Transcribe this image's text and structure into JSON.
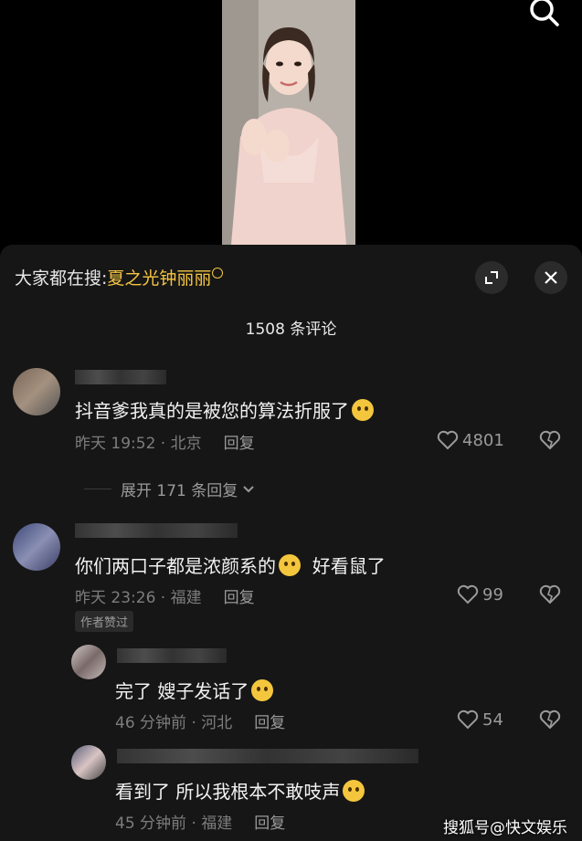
{
  "search": {
    "prefix": "大家都在搜:",
    "keyword": "夏之光钟丽丽"
  },
  "comments_count": "1508 条评论",
  "comments": [
    {
      "text": "抖音爹我真的是被您的算法折服了",
      "time": "昨天 19:52",
      "location": "北京",
      "reply": "回复",
      "likes": "4801",
      "expand": "展开 171 条回复"
    },
    {
      "text_a": "你们两口子都是浓颜系的",
      "text_b": "好看鼠了",
      "time": "昨天 23:26",
      "location": "福建",
      "reply": "回复",
      "likes": "99",
      "badge": "作者赞过"
    }
  ],
  "replies": [
    {
      "text": "完了 嫂子发话了",
      "time": "46 分钟前",
      "location": "河北",
      "reply": "回复",
      "likes": "54"
    },
    {
      "text": "看到了 所以我根本不敢吱声",
      "time": "45 分钟前",
      "location": "福建",
      "reply": "回复"
    }
  ],
  "watermark": "搜狐号@快文娱乐",
  "colors": {
    "accent": "#f5c542",
    "panel": "#161616"
  }
}
